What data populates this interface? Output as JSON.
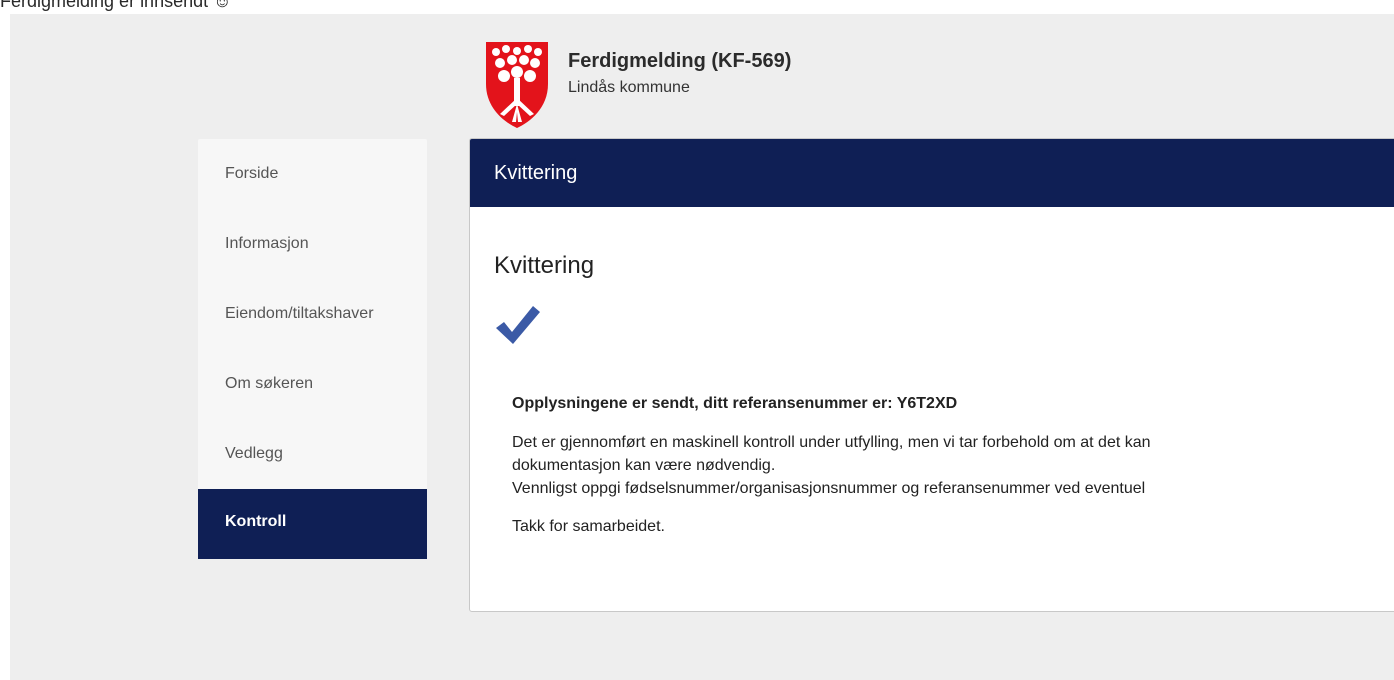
{
  "caption": "Ferdigmelding er innsendt ☺",
  "header": {
    "title": "Ferdigmelding (KF-569)",
    "subtitle": "Lindås kommune"
  },
  "sidebar": {
    "items": [
      {
        "label": "Forside"
      },
      {
        "label": "Informasjon"
      },
      {
        "label": "Eiendom/tiltakshaver"
      },
      {
        "label": "Om søkeren"
      },
      {
        "label": "Vedlegg"
      },
      {
        "label": "Kontroll",
        "active": true
      }
    ]
  },
  "panel": {
    "header": "Kvittering",
    "title": "Kvittering",
    "reference_line": "Opplysningene er sendt, ditt referansenummer er: Y6T2XD",
    "line1": "Det er gjennomført en maskinell kontroll under utfylling, men vi tar forbehold om at det kan",
    "line2": "dokumentasjon kan være nødvendig.",
    "line3": "Vennligst oppgi fødselsnummer/organisasjonsnummer og referansenummer ved eventuel",
    "thanks": "Takk for samarbeidet."
  },
  "colors": {
    "brand": "#0f1f55",
    "background": "#eeeeee",
    "check": "#3b5aa6",
    "crest_red": "#e3131b"
  },
  "icons": {
    "crest": "municipal-crest-icon",
    "check": "checkmark-icon"
  }
}
